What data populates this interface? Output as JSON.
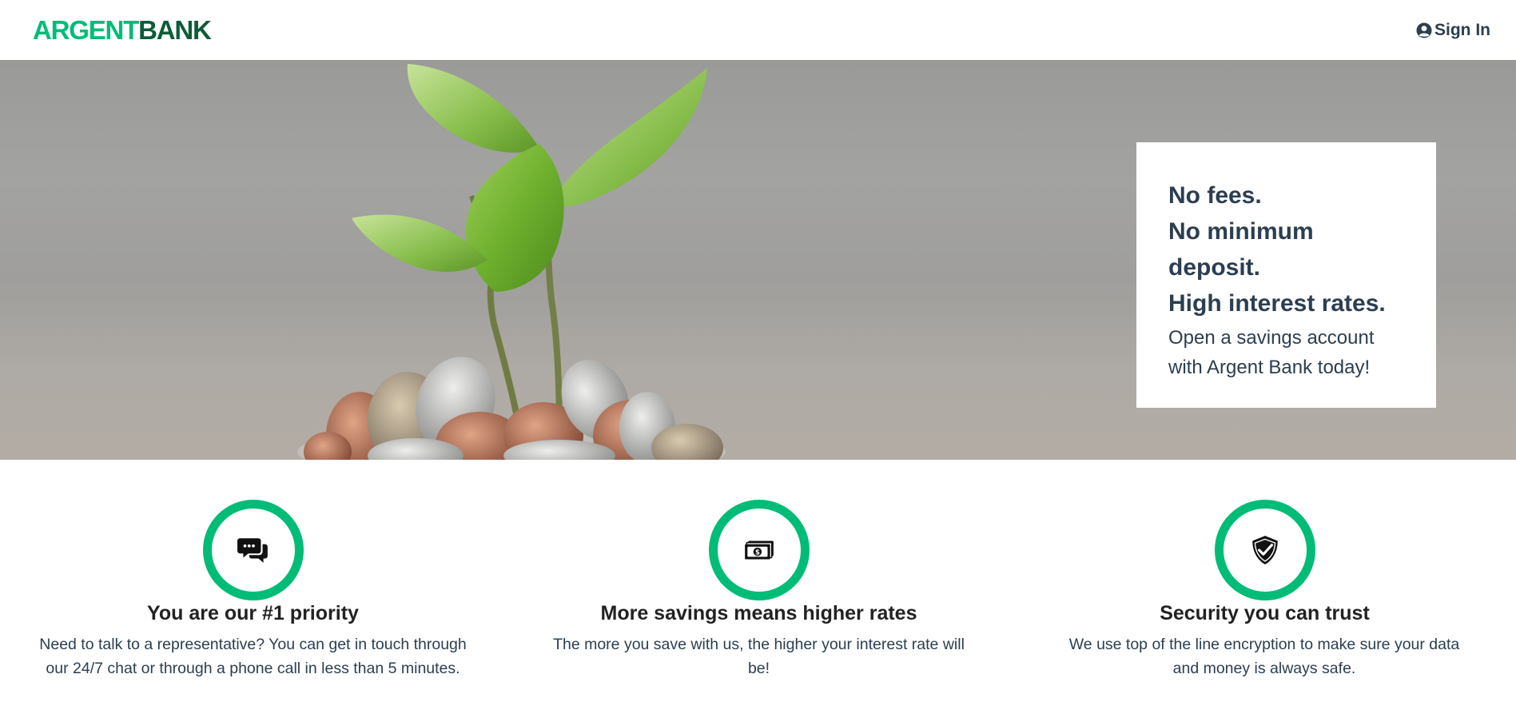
{
  "brand": {
    "logo_part1": "ARGENT",
    "logo_part2": "BANK"
  },
  "nav": {
    "signin_label": "Sign In",
    "signin_icon": "user-circle-icon"
  },
  "hero": {
    "image_description": "plant-sprouting-from-coins",
    "subtitles": [
      "No fees.",
      "No minimum deposit.",
      "High interest rates."
    ],
    "text": "Open a savings account with Argent Bank today!"
  },
  "features": [
    {
      "icon": "chat-icon",
      "title": "You are our #1 priority",
      "text": "Need to talk to a representative? You can get in touch through our 24/7 chat or through a phone call in less than 5 minutes."
    },
    {
      "icon": "money-icon",
      "title": "More savings means higher rates",
      "text": "The more you save with us, the higher your interest rate will be!"
    },
    {
      "icon": "security-shield-icon",
      "title": "Security you can trust",
      "text": "We use top of the line encryption to make sure your data and money is always safe."
    }
  ],
  "colors": {
    "accent": "#00bc77",
    "brand_dark": "#0c5c3a",
    "text": "#2c3e50"
  }
}
